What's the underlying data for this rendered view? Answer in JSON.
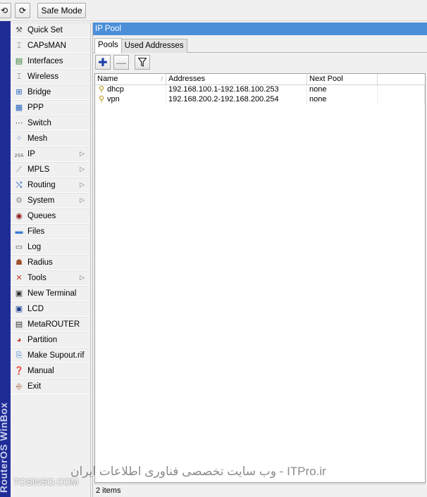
{
  "toolbar": {
    "undo_icon": "undo-icon",
    "redo_icon": "redo-icon",
    "undo_glyph": "⟲",
    "redo_glyph": "⟳",
    "safe_mode_label": "Safe Mode"
  },
  "brand": {
    "text": "RouterOS WinBox"
  },
  "sidebar": {
    "items": [
      {
        "label": "Quick Set",
        "icon": "quick-set-icon",
        "glyph": "⚒",
        "color": "#555555",
        "submenu": false
      },
      {
        "label": "CAPsMAN",
        "icon": "capsman-icon",
        "glyph": "⌶",
        "color": "#666666",
        "submenu": false
      },
      {
        "label": "Interfaces",
        "icon": "interfaces-icon",
        "glyph": "▤",
        "color": "#2e7d32",
        "submenu": false
      },
      {
        "label": "Wireless",
        "icon": "wireless-icon",
        "glyph": "⌶",
        "color": "#666666",
        "submenu": false
      },
      {
        "label": "Bridge",
        "icon": "bridge-icon",
        "glyph": "⊞",
        "color": "#1f5fbf",
        "submenu": false
      },
      {
        "label": "PPP",
        "icon": "ppp-icon",
        "glyph": "▦",
        "color": "#1f5fbf",
        "submenu": false
      },
      {
        "label": "Switch",
        "icon": "switch-icon",
        "glyph": "⋯",
        "color": "#555555",
        "submenu": false
      },
      {
        "label": "Mesh",
        "icon": "mesh-icon",
        "glyph": "⁘",
        "color": "#1f5fbf",
        "submenu": false
      },
      {
        "label": "IP",
        "icon": "ip-icon",
        "glyph": "₂₅₅",
        "color": "#444444",
        "submenu": true
      },
      {
        "label": "MPLS",
        "icon": "mpls-icon",
        "glyph": "⟋",
        "color": "#777777",
        "submenu": true
      },
      {
        "label": "Routing",
        "icon": "routing-icon",
        "glyph": "⤭",
        "color": "#1f5fbf",
        "submenu": true
      },
      {
        "label": "System",
        "icon": "system-icon",
        "glyph": "⚙",
        "color": "#888888",
        "submenu": true
      },
      {
        "label": "Queues",
        "icon": "queues-icon",
        "glyph": "◉",
        "color": "#8b1a1a",
        "submenu": false
      },
      {
        "label": "Files",
        "icon": "files-icon",
        "glyph": "▬",
        "color": "#3a7bd5",
        "submenu": false
      },
      {
        "label": "Log",
        "icon": "log-icon",
        "glyph": "▭",
        "color": "#555555",
        "submenu": false
      },
      {
        "label": "Radius",
        "icon": "radius-icon",
        "glyph": "☗",
        "color": "#a0522d",
        "submenu": false
      },
      {
        "label": "Tools",
        "icon": "tools-icon",
        "glyph": "✕",
        "color": "#c0392b",
        "submenu": true
      },
      {
        "label": "New Terminal",
        "icon": "terminal-icon",
        "glyph": "▣",
        "color": "#333333",
        "submenu": false
      },
      {
        "label": "LCD",
        "icon": "lcd-icon",
        "glyph": "▣",
        "color": "#1f3f8f",
        "submenu": false
      },
      {
        "label": "MetaROUTER",
        "icon": "metarouter-icon",
        "glyph": "▤",
        "color": "#333333",
        "submenu": false
      },
      {
        "label": "Partition",
        "icon": "partition-icon",
        "glyph": "◕",
        "color": "#c0392b",
        "submenu": false
      },
      {
        "label": "Make Supout.rif",
        "icon": "supout-icon",
        "glyph": "⎘",
        "color": "#3a7bd5",
        "submenu": false
      },
      {
        "label": "Manual",
        "icon": "manual-icon",
        "glyph": "❓",
        "color": "#1f5fbf",
        "submenu": false
      },
      {
        "label": "Exit",
        "icon": "exit-icon",
        "glyph": "⎆",
        "color": "#a0522d",
        "submenu": false
      }
    ],
    "submenu_arrow": "▷"
  },
  "window": {
    "title": "IP Pool",
    "tabs": [
      {
        "label": "Pools",
        "active": true
      },
      {
        "label": "Used Addresses",
        "active": false
      }
    ],
    "add_glyph": "✚",
    "remove_glyph": "—",
    "filter_icon": "filter-icon"
  },
  "table": {
    "columns": [
      "Name",
      "Addresses",
      "Next Pool",
      ""
    ],
    "sort_glyph": "/",
    "row_glyph": "⚲",
    "rows": [
      {
        "name": "dhcp",
        "addresses": "192.168.100.1-192.168.100.253",
        "next_pool": "none"
      },
      {
        "name": "vpn",
        "addresses": "192.168.200.2-192.168.200.254",
        "next_pool": "none"
      }
    ]
  },
  "status": {
    "items_count": "2 items"
  },
  "watermark": {
    "main": "ITPro.ir - وب سایت تخصصی فناوری اطلاعات ایران",
    "site": "TOSINSO.COM"
  }
}
